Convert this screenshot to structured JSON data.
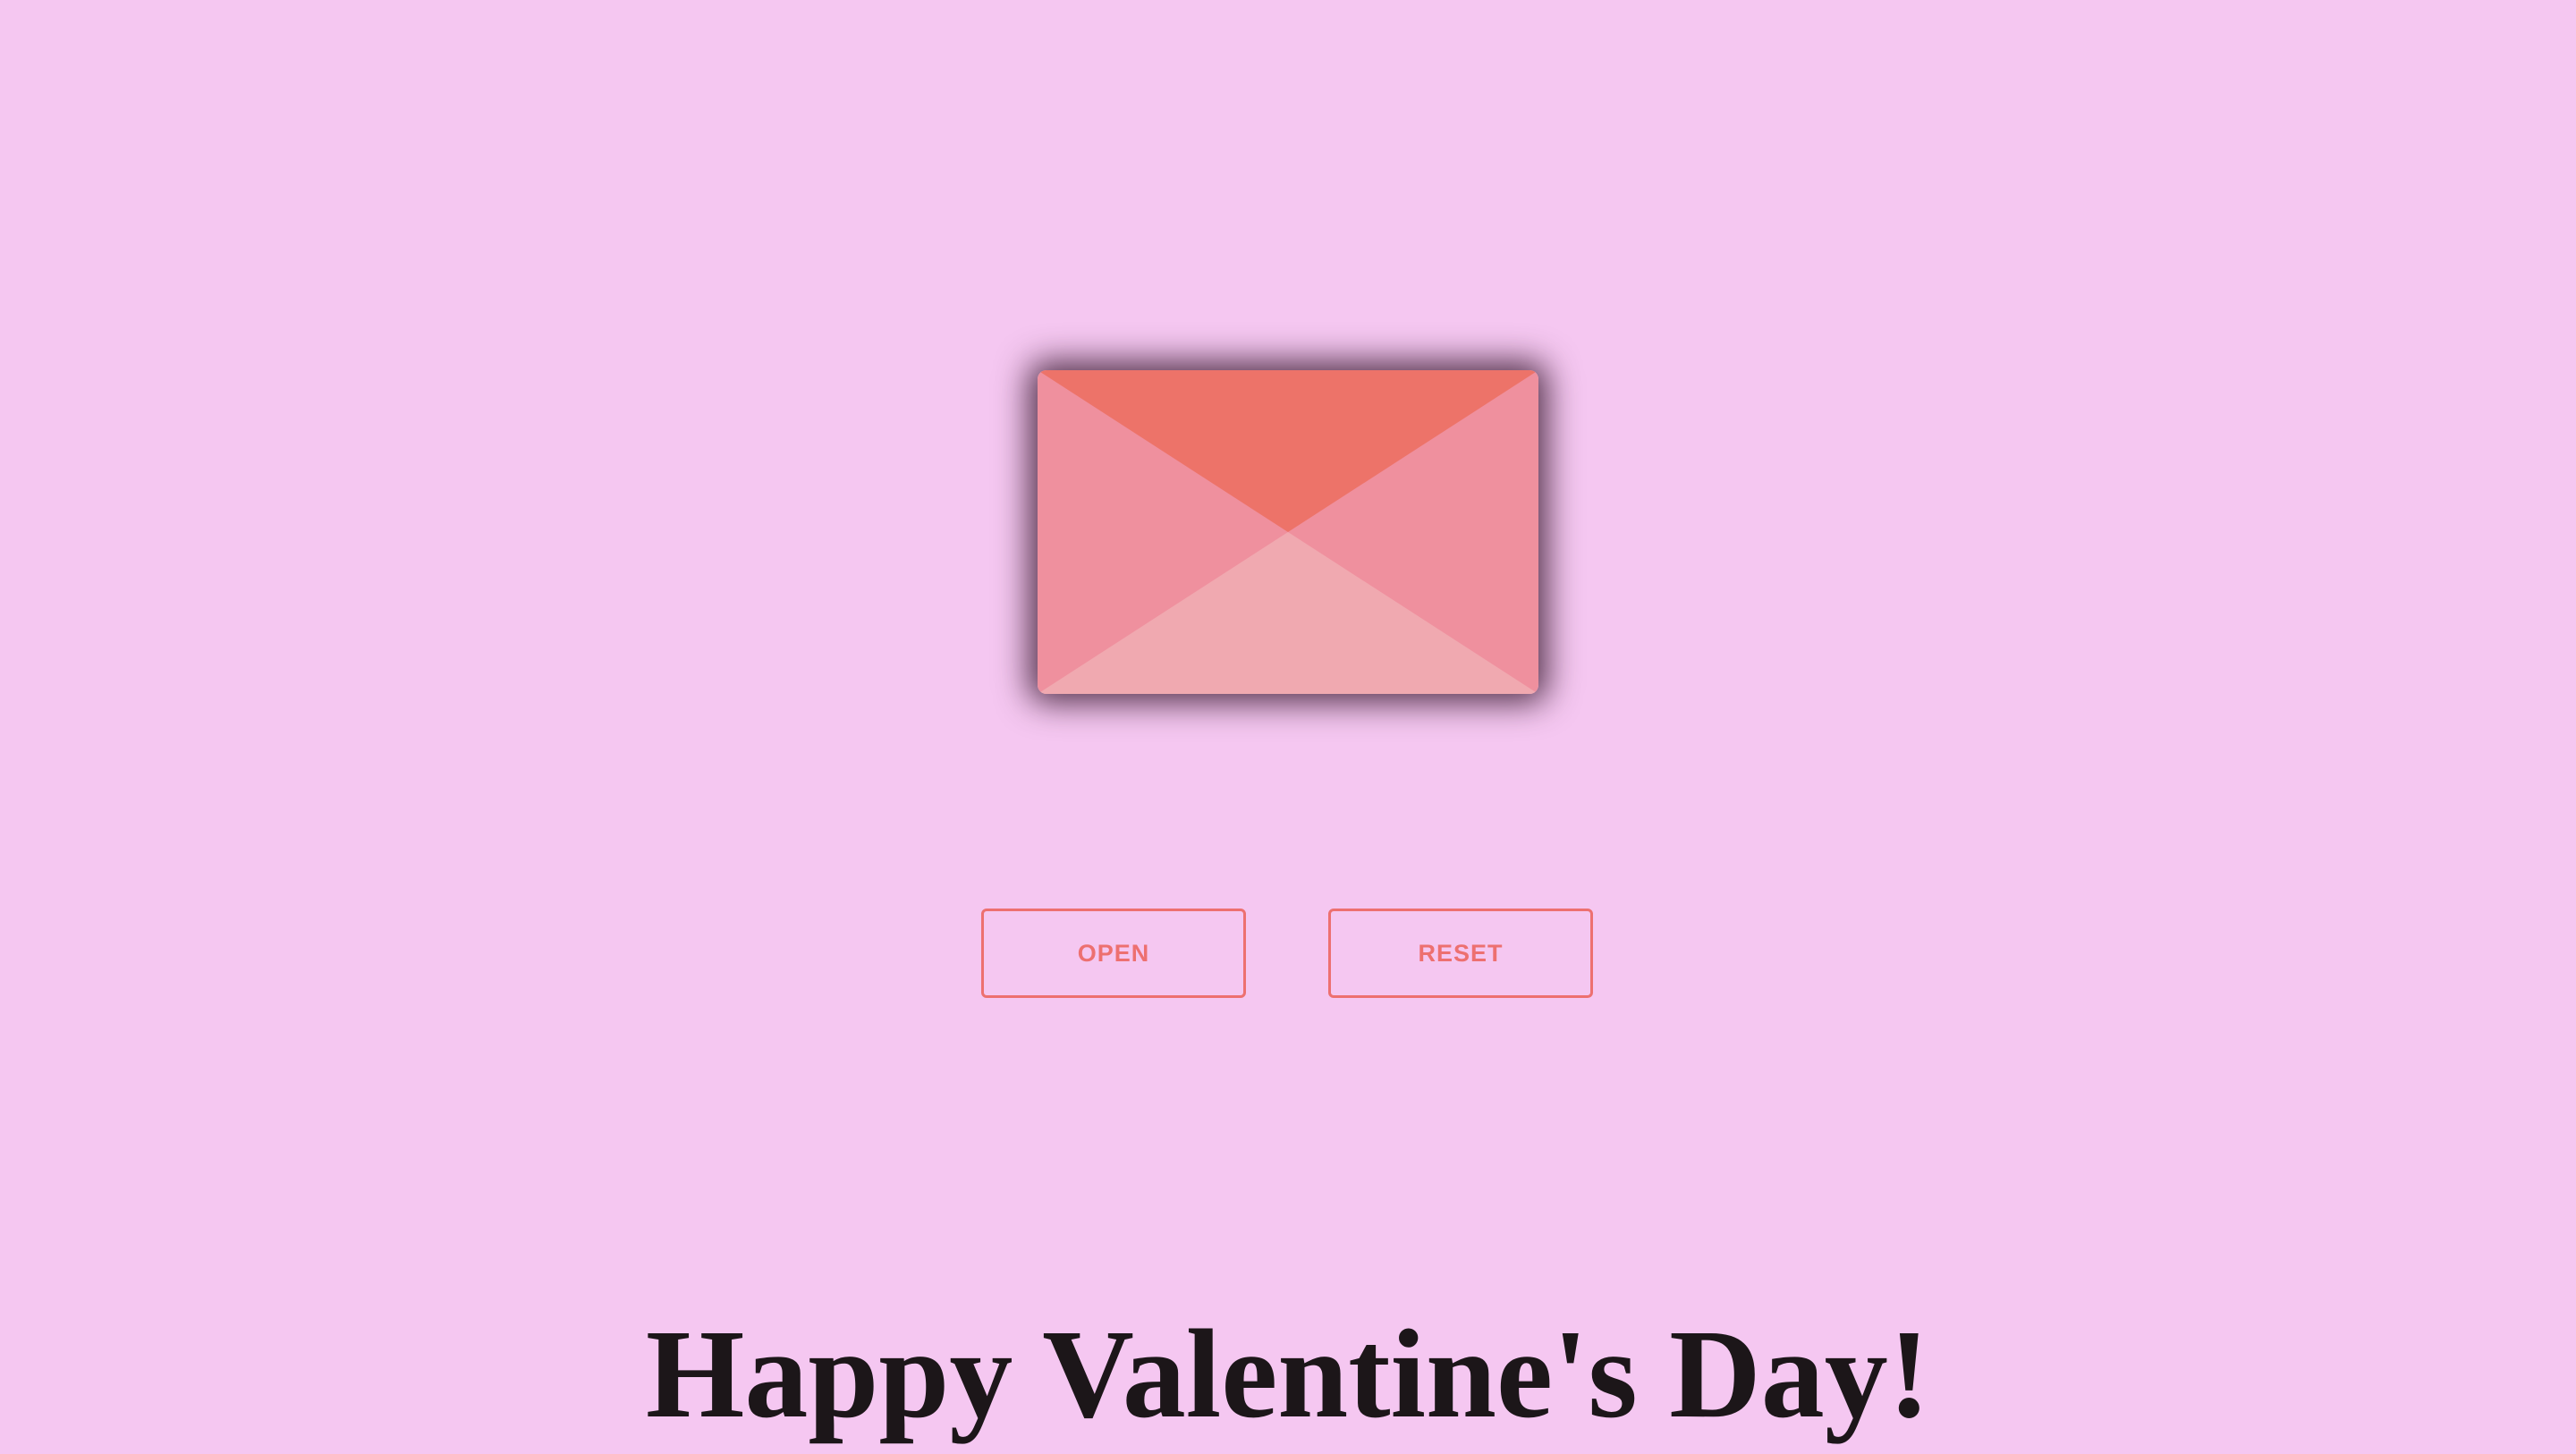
{
  "envelope": {
    "colors": {
      "side_flaps": "#ef909e",
      "top_flap": "#ed7369",
      "bottom_flap": "#f0a9b0"
    }
  },
  "buttons": {
    "open_label": "OPEN",
    "reset_label": "RESET",
    "accent_color": "#ed7070"
  },
  "greeting": {
    "text": "Happy Valentine's Day!"
  },
  "background_color": "#f5c7f1"
}
